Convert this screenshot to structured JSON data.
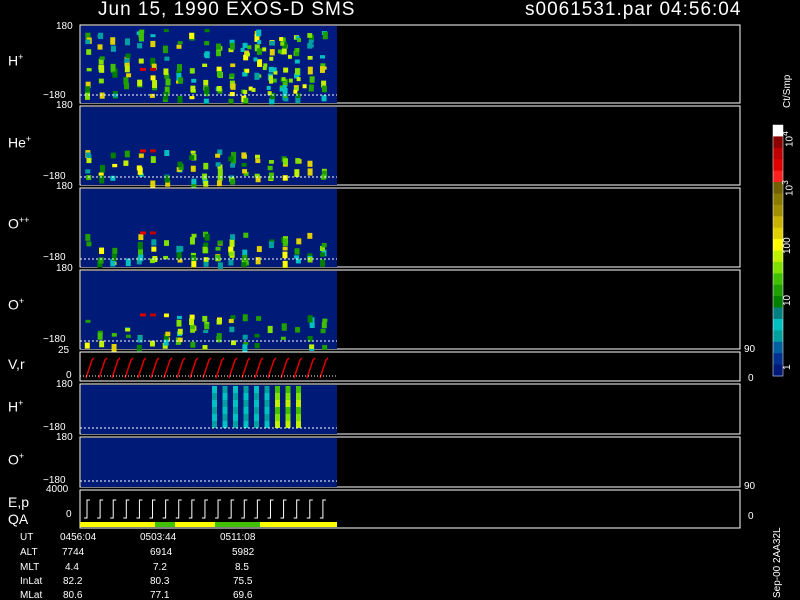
{
  "header": {
    "date_mission": "Jun 15, 1990   EXOS-D SMS",
    "file_time": "s0061531.par  04:56:04"
  },
  "panels": [
    {
      "key": "h_plus",
      "label": "H",
      "sup": "+",
      "ymax": "180",
      "ymin": "−180",
      "kind": "spectrogram"
    },
    {
      "key": "he_plus",
      "label": "He",
      "sup": "+",
      "ymax": "180",
      "ymin": "−180",
      "kind": "spectrogram"
    },
    {
      "key": "o_pp",
      "label": "O",
      "sup": "++",
      "ymax": "180",
      "ymin": "−180",
      "kind": "spectrogram"
    },
    {
      "key": "o_plus",
      "label": "O",
      "sup": "+",
      "ymax": "180",
      "ymin": "−180",
      "kind": "spectrogram"
    },
    {
      "key": "vr",
      "label": "V,r",
      "sup": "",
      "ymax": "25",
      "ymin": "0",
      "right_top": "90",
      "right_bottom": "0",
      "kind": "line"
    },
    {
      "key": "h_plus_2",
      "label": "H",
      "sup": "+",
      "ymax": "180",
      "ymin": "−180",
      "kind": "spectrogram"
    },
    {
      "key": "o_plus_2",
      "label": "O",
      "sup": "+",
      "ymax": "180",
      "ymin": "−180",
      "kind": "spectrogram"
    },
    {
      "key": "ep_qa",
      "label": "E,p",
      "label2": "QA",
      "ymax": "4000",
      "ymin": "0",
      "right_top": "90",
      "right_bottom": "0",
      "kind": "steps"
    }
  ],
  "colorbar": {
    "unit": "Ct/Smp",
    "labels": [
      {
        "text": "10",
        "sup": "4"
      },
      {
        "text": "10",
        "sup": "3"
      },
      {
        "text": "100",
        "sup": ""
      },
      {
        "text": "10",
        "sup": ""
      },
      {
        "text": "1",
        "sup": ""
      }
    ],
    "colors": [
      "#ffffff",
      "#8b0000",
      "#c00000",
      "#e00000",
      "#ff2020",
      "#706000",
      "#8a7a00",
      "#a09000",
      "#c8b400",
      "#e0d000",
      "#ffff00",
      "#c0f000",
      "#80e000",
      "#40c000",
      "#20a000",
      "#008000",
      "#008080",
      "#00c0c0",
      "#00a0a0",
      "#0060a0",
      "#003090",
      "#001878"
    ]
  },
  "ephemeris": {
    "rows": [
      {
        "label": "UT",
        "values": [
          "0456:04",
          "0503:44",
          "0511:08"
        ]
      },
      {
        "label": "ALT",
        "values": [
          "7744",
          "6914",
          "5982"
        ]
      },
      {
        "label": "MLT",
        "values": [
          "4.4",
          "7.2",
          "8.5"
        ]
      },
      {
        "label": "InLat",
        "values": [
          "82.2",
          "80.3",
          "75.5"
        ]
      },
      {
        "label": "MLat",
        "values": [
          "80.6",
          "77.1",
          "69.6"
        ]
      }
    ]
  },
  "footer_stamp": "Sep-00  2AA32L",
  "chart_data": {
    "type": "heatmap",
    "title": "Jun 15, 1990   EXOS-D SMS",
    "file": "s0061531.par",
    "time": "04:56:04",
    "x_ticks_ut": [
      "0456:04",
      "0503:44",
      "0511:08"
    ],
    "species": [
      "H+",
      "He+",
      "O++",
      "O+",
      "V,r",
      "H+",
      "O+",
      "E,p QA"
    ],
    "y_range_pitch": [
      -180,
      180
    ],
    "vr_range": [
      0,
      25
    ],
    "vr_right_range": [
      0,
      90
    ],
    "ep_range": [
      0,
      4000
    ],
    "ep_right_range": [
      0,
      90
    ],
    "colorbar_range": [
      1,
      10000
    ],
    "colorbar_scale": "log",
    "colorbar_unit": "Ct/Smp",
    "data_fraction_of_time_span": 0.39
  }
}
